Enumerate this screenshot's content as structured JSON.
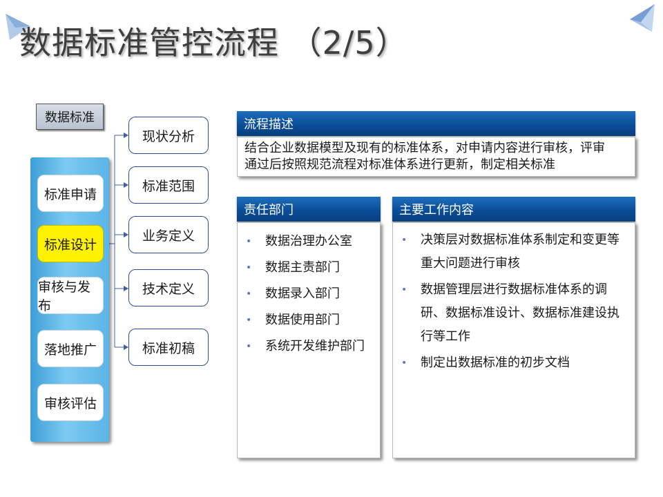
{
  "title": "数据标准管控流程 （2/5）",
  "root_node": "数据标准",
  "steps": [
    {
      "label": "标准申请",
      "active": false
    },
    {
      "label": "标准设计",
      "active": true
    },
    {
      "label": "审核与发布",
      "active": false
    },
    {
      "label": "落地推广",
      "active": false
    },
    {
      "label": "审核评估",
      "active": false
    }
  ],
  "sub_steps": [
    "现状分析",
    "标准范围",
    "业务定义",
    "技术定义",
    "标准初稿"
  ],
  "process_description": {
    "header": "流程描述",
    "lines": [
      "结合企业数据模型及现有的标准体系，对申请内容进行审核，评审",
      "通过后按照规范流程对标准体系进行更新，制定相关标准"
    ]
  },
  "responsible_departments": {
    "header": "责任部门",
    "items": [
      "数据治理办公室",
      "数据主责部门",
      "数据录入部门",
      "数据使用部门",
      "系统开发维护部门"
    ]
  },
  "main_work": {
    "header": "主要工作内容",
    "items": [
      "决策层对数据标准体系制定和变更等重大问题进行审核",
      "数据管理层进行数据标准体系的调研、数据标准设计、数据标准建设执行等工作",
      "制定出数据标准的初步文档"
    ]
  },
  "colors": {
    "header_blue": "#0b4d98",
    "active_step": "#fff200",
    "panel_blue": "#5ab4e6",
    "bullet": "#5a7ab8"
  },
  "bullet_glyph": "•"
}
